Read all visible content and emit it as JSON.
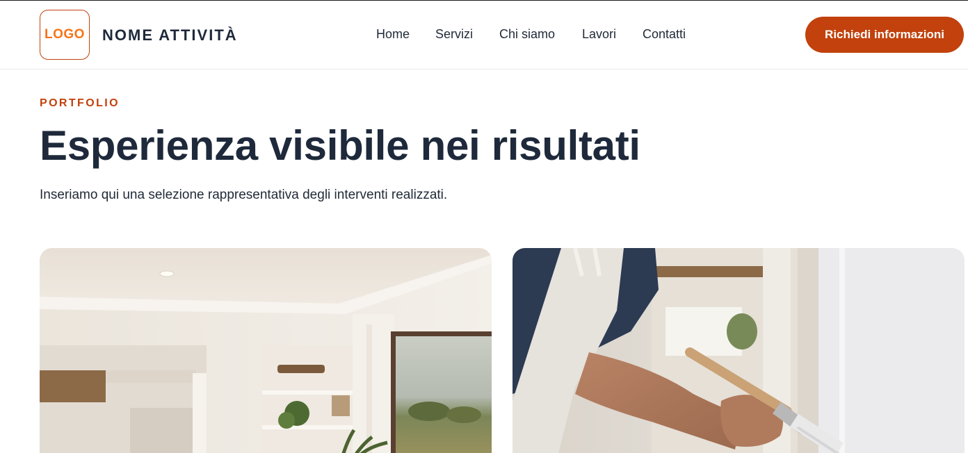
{
  "header": {
    "logo_text": "LOGO",
    "brand_name": "NOME ATTIVITÀ",
    "nav": [
      {
        "label": "Home"
      },
      {
        "label": "Servizi"
      },
      {
        "label": "Chi siamo"
      },
      {
        "label": "Lavori"
      },
      {
        "label": "Contatti"
      }
    ],
    "cta_label": "Richiedi informazioni"
  },
  "portfolio": {
    "eyebrow": "PORTFOLIO",
    "title": "Esperienza visibile nei risultati",
    "lead": "Inseriamo qui una selezione rappresentativa degli interventi realizzati.",
    "cards": [
      {
        "image": "interior-living-room-photo"
      },
      {
        "image": "painter-with-brush-photo"
      }
    ]
  },
  "colors": {
    "accent": "#c2410c",
    "logo_text": "#f97316",
    "heading": "#1e293b"
  }
}
